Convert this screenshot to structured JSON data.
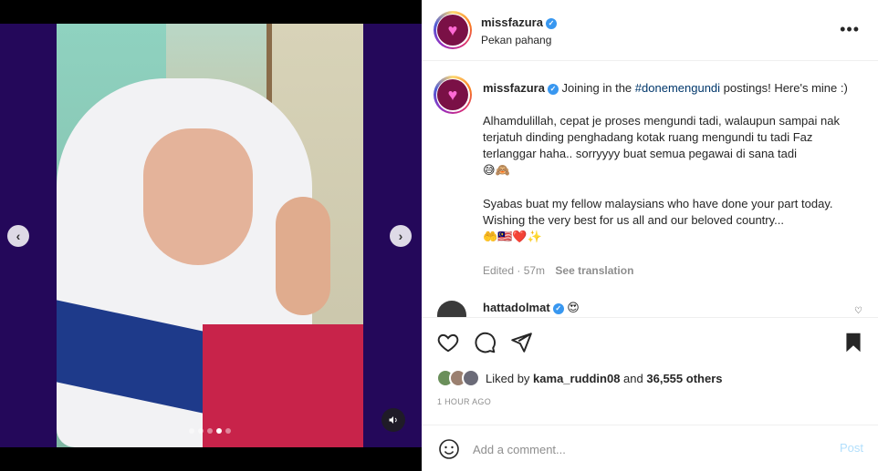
{
  "post": {
    "username": "missfazura",
    "location": "Pekan pahang",
    "caption_intro": "Joining in the",
    "hashtag": "#donemengundi",
    "caption_intro_end": "postings! Here's mine :)",
    "paragraph1": "Alhamdulillah, cepat je proses mengundi tadi, walaupun sampai nak terjatuh dinding penghadang kotak ruang mengundi tu tadi Faz terlanggar haha.. sorryyyy buat semua pegawai di sana tadi",
    "paragraph1_emoji": "😅🙈",
    "paragraph2": "Syabas buat my fellow malaysians who have done your part today. Wishing the very best for us all and our beloved country...",
    "paragraph2_emoji": "🤲🇲🇾❤️✨",
    "edited": "Edited · 57m",
    "see_translation": "See translation"
  },
  "reply": {
    "username": "hattadolmat",
    "emoji": "😍"
  },
  "likes": {
    "prefix": "Liked by",
    "user": "kama_ruddin08",
    "and": "and",
    "others": "36,555 others"
  },
  "time": "1 HOUR AGO",
  "composer": {
    "placeholder": "Add a comment...",
    "post_label": "Post"
  },
  "carousel": {
    "slide_count": 5,
    "active_index": 3
  },
  "colors": {
    "accent": "#3897f0",
    "hashtag": "#00376b",
    "post_disabled": "#b2dffc",
    "media_bg": "#24085a"
  },
  "icons": {
    "prev": "chevron-left-icon",
    "next": "chevron-right-icon",
    "sound": "speaker-icon",
    "more": "more-horizontal-icon",
    "like": "heart-icon",
    "comment": "comment-icon",
    "share": "send-icon",
    "save": "bookmark-icon",
    "emoji": "smiley-icon",
    "verified": "verified-badge-icon"
  }
}
